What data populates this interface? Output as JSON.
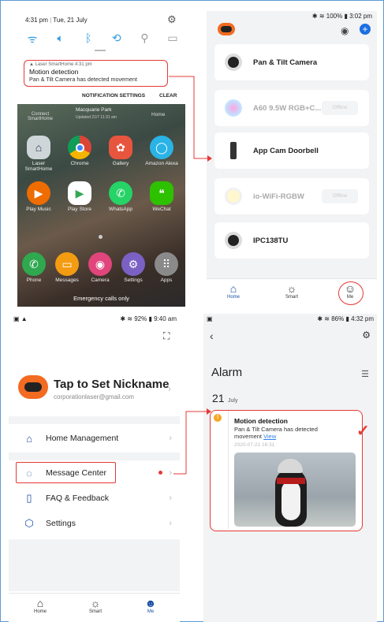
{
  "panel_a": {
    "status": {
      "time": "4:31 pm",
      "date": "Tue, 21 July"
    },
    "quick_settings": [
      "wifi-icon",
      "sound-icon",
      "bluetooth-icon",
      "rotate-icon",
      "flashlight-icon",
      "battery-saver-icon"
    ],
    "notification": {
      "source": "Laser SmartHome",
      "time": "4:31 pm",
      "title": "Motion detection",
      "body": "Pan & Tilt Camera has detected movement"
    },
    "actions": {
      "settings": "NOTIFICATION SETTINGS",
      "clear": "CLEAR"
    },
    "widget": {
      "city": "Macquarie Park",
      "updated": "Updated 21/7 11:31 am"
    },
    "top_row": [
      "Connect SmartHome",
      "Home"
    ],
    "apps_row1": [
      "Laser SmartHome",
      "Chrome",
      "Gallery",
      "Amazon Alexa"
    ],
    "apps_row2": [
      "Play Music",
      "Play Store",
      "WhatsApp",
      "WeChat"
    ],
    "dock": [
      "Phone",
      "Messages",
      "Camera",
      "Settings",
      "Apps"
    ],
    "emergency": "Emergency calls only"
  },
  "panel_b": {
    "status": "100% ▮ 3:02 pm",
    "devices": [
      {
        "name": "Pan & Tilt Camera",
        "offline": false
      },
      {
        "name": "A60 9.5W RGB+C...",
        "offline": true,
        "badge": "Offline"
      },
      {
        "name": "App Cam Doorbell",
        "offline": false
      },
      {
        "name": "io-WiFi-RGBW",
        "offline": true,
        "badge": "Offline"
      },
      {
        "name": "IPC138TU",
        "offline": false
      }
    ],
    "tabs": [
      "Home",
      "Smart",
      "Me"
    ]
  },
  "panel_c": {
    "status": "92% ▮ 9:40 am",
    "nickname": "Tap to Set Nickname",
    "email": "corporationlaser@gmail.com",
    "menu": [
      "Home Management",
      "Message Center",
      "FAQ & Feedback",
      "Settings"
    ],
    "tabs": [
      "Home",
      "Smart",
      "Me"
    ]
  },
  "panel_d": {
    "status": "86% ▮ 4:32 pm",
    "title": "Alarm",
    "day": "21",
    "month": "July",
    "alarm": {
      "title": "Motion detection",
      "body": "Pan & Tilt Camera has detected movement",
      "link": "View",
      "timestamp": "2020-07-21 16:31"
    }
  },
  "colors": {
    "accent": "#1b4fa6",
    "highlight": "#e53935",
    "link": "#2f80ed",
    "frame": "#5b9bd5"
  }
}
